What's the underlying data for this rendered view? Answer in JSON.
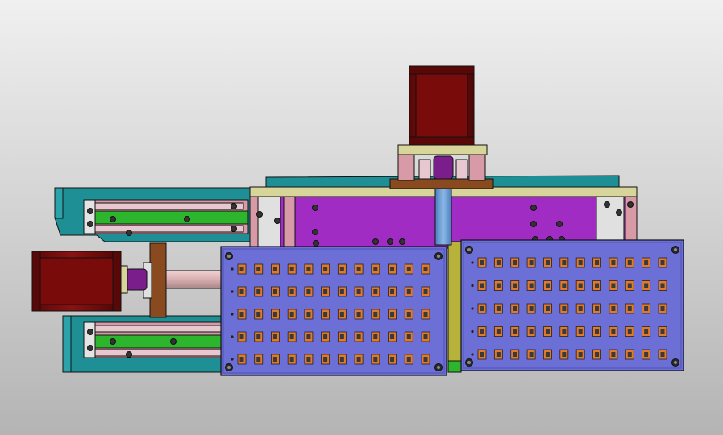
{
  "scene": {
    "view": "cad-3d-assembly",
    "background": {
      "top": "#f0f0f0",
      "bottom": "#b4b4b4"
    },
    "colors": {
      "motor": "#7a0b0b",
      "motor_dark": "#4d0606",
      "frame_teal": "#1f8f96",
      "plate_purple": "#a12cc4",
      "panel_blue": "#6b6fd6",
      "panel_blue_dark": "#4e52b8",
      "slot_orange": "#e07a2a",
      "rail_green": "#2db52d",
      "pink": "#d79aa6",
      "tan": "#d8d59a",
      "copper": "#8a4a1f",
      "shaft": "#d8aeb0",
      "coupling_purple": "#7a1e8c",
      "steel_blue": "#6aa0d8"
    },
    "panels": [
      {
        "id": "left",
        "rows": 5,
        "cols": 12
      },
      {
        "id": "right",
        "rows": 5,
        "cols": 12
      }
    ],
    "motors": [
      {
        "id": "vertical-stepper-motor"
      },
      {
        "id": "horizontal-stepper-motor"
      }
    ]
  }
}
